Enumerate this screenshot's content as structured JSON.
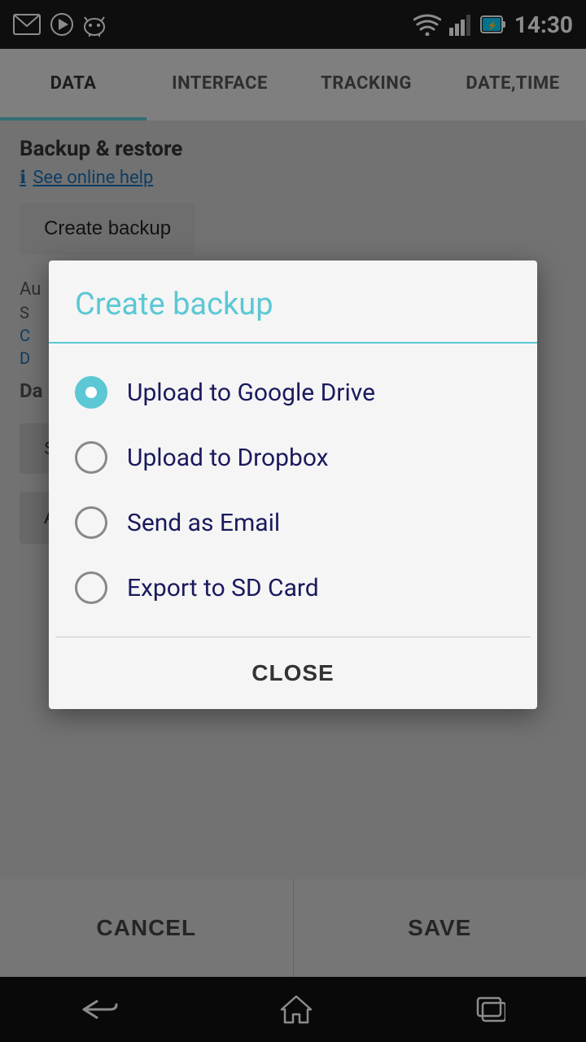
{
  "statusBar": {
    "time": "14:30",
    "icons": [
      "email",
      "play",
      "android",
      "wifi",
      "signal",
      "battery"
    ]
  },
  "tabs": [
    {
      "label": "DATA",
      "active": true
    },
    {
      "label": "INTERFACE",
      "active": false
    },
    {
      "label": "TRACKING",
      "active": false
    },
    {
      "label": "DATE,TIME",
      "active": false
    }
  ],
  "page": {
    "sectionTitle": "Backup & restore",
    "helpLink": "See online help",
    "createBackupBtn": "Create backup",
    "autoLabel": "Au",
    "subValue": "S",
    "subItem": "C",
    "blueLink": "D",
    "dataLabel": "Da",
    "storageAdminBtn": "Storage admin",
    "archiveBtn": "Archive",
    "cancelBtn": "CANCEL",
    "saveBtn": "SAVE"
  },
  "dialog": {
    "title": "Create backup",
    "options": [
      {
        "label": "Upload to Google Drive",
        "selected": true
      },
      {
        "label": "Upload to Dropbox",
        "selected": false
      },
      {
        "label": "Send as Email",
        "selected": false
      },
      {
        "label": "Export to SD Card",
        "selected": false
      }
    ],
    "closeBtn": "CLOSE"
  },
  "navBar": {
    "back": "←",
    "home": "⌂",
    "recents": "▭"
  },
  "colors": {
    "accent": "#5bc8d4",
    "titleColor": "#5bc8d4",
    "textDark": "#1a1a5e",
    "linkColor": "#1a6fb5"
  }
}
